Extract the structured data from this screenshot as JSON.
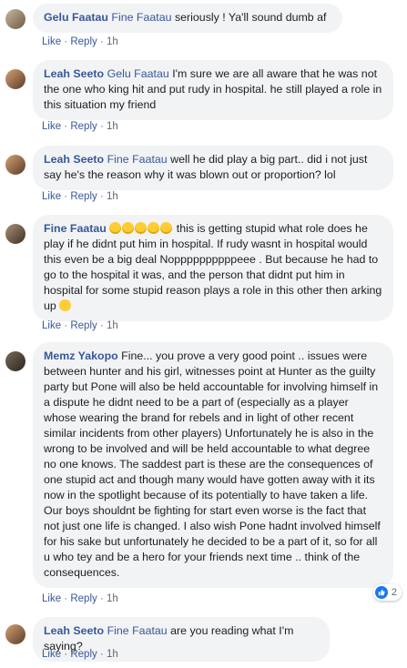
{
  "comments": [
    {
      "author": "Gelu Faatau",
      "tag": "Fine Faatau",
      "text": " seriously ! Ya'll sound dumb af",
      "like": "Like",
      "reply": "Reply",
      "time": "1h"
    },
    {
      "author": "Leah Seeto",
      "tag": "Gelu Faatau",
      "text": " I'm sure we are all aware that he was not the one who king hit and put rudy in hospital. he still played a role in this situation my friend",
      "like": "Like",
      "reply": "Reply",
      "time": "1h"
    },
    {
      "author": "Leah Seeto",
      "tag": "Fine Faatau",
      "text": " well he did play a big part.. did i not just say he's the reason why it was blown out or proportion? lol",
      "like": "Like",
      "reply": "Reply",
      "time": "1h"
    },
    {
      "author": "Fine Faatau",
      "text": " this is getting stupid what role does he play if he didnt put him in hospital. If rudy wasnt in hospital would this even be a big deal Noppppppppppeee . But because he had to go to the hospital it was, and the person that didnt put him in hospital for some stupid reason plays a role in this other then arking up ",
      "emoji_count": 5,
      "like": "Like",
      "reply": "Reply",
      "time": "1h"
    },
    {
      "author": "Memz Yakopo",
      "text": " Fine... you prove a very good point .. issues were between hunter and his girl, witnesses point at Hunter as the guilty party but Pone will also be held accountable for involving himself in a dispute he didnt need to be a part of (especially as a player whose wearing the brand for rebels and in light of other recent similar incidents from other players) Unfortunately he is also in the wrong to be involved and will be held accountable to what degree no one knows. The saddest part is these are the consequences of one stupid act and though many would have gotten away with it its now in the spotlight because of its potentially to have taken a life. Our boys shouldnt be fighting for start even worse is the fact that not just one life is changed. I also wish Pone hadnt involved himself for his sake but unfortunately he decided to be a part of it, so for all u who tey and be a hero for your friends next time .. think of the consequences.",
      "reaction_count": "2",
      "like": "Like",
      "reply": "Reply",
      "time": "1h"
    },
    {
      "author": "Leah Seeto",
      "tag": "Fine Faatau",
      "text": " are you reading what I'm saying?",
      "like": "Like",
      "reply": "Reply",
      "time": "1h"
    }
  ],
  "colors": {
    "bubble": "#f2f3f5",
    "name": "#385898",
    "meta": "#606770",
    "like_blue": "#1877f2"
  },
  "icons": {
    "laugh": "grinning-squinting-face-emoji",
    "think": "thinking-face-emoji",
    "reaction": "thumbs-up-icon"
  }
}
